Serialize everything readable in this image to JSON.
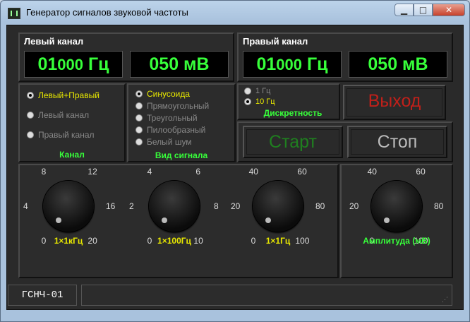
{
  "window": {
    "title": "Генератор сигналов звуковой частоты"
  },
  "left_channel": {
    "label": "Левый канал",
    "freq_main": "01",
    "freq_small": "000",
    "freq_unit": "Гц",
    "amp": "050 мВ"
  },
  "right_channel": {
    "label": "Правый канал",
    "freq_main": "01",
    "freq_small": "000",
    "freq_unit": "Гц",
    "amp": "050 мВ"
  },
  "channel": {
    "options": [
      "Левый+Правый",
      "Левый канал",
      "Правый канал"
    ],
    "selected": 0,
    "caption": "Канал"
  },
  "waveform": {
    "options": [
      "Синусоида",
      "Прямоугольный",
      "Треугольный",
      "Пилообразный",
      "Белый шум"
    ],
    "selected": 0,
    "caption": "Вид сигнала"
  },
  "discrete": {
    "options": [
      "1 Гц",
      "10 Гц"
    ],
    "selected": 1,
    "caption": "Дискретность"
  },
  "buttons": {
    "exit": "Выход",
    "start": "Старт",
    "stop": "Стоп"
  },
  "knobs": [
    {
      "caption": "1×1кГц",
      "ticks": [
        "0",
        "4",
        "8",
        "12",
        "16",
        "20"
      ],
      "value_fraction": 0.0
    },
    {
      "caption": "1×100Гц",
      "ticks": [
        "0",
        "2",
        "4",
        "6",
        "8",
        "10"
      ],
      "value_fraction": 0.0
    },
    {
      "caption": "1×1Гц",
      "ticks": [
        "0",
        "20",
        "40",
        "60",
        "80",
        "100"
      ],
      "value_fraction": 0.0
    },
    {
      "caption": "Амплитуда (мВ)",
      "ticks": [
        "0",
        "20",
        "40",
        "60",
        "80",
        "100"
      ],
      "value_fraction": 0.0
    }
  ],
  "status": {
    "device": "ГСНЧ-01",
    "message": ""
  },
  "colors": {
    "lcd_green": "#37ff3a",
    "yellow": "#e8e800",
    "exit_red": "#c0201a",
    "start_green": "#1f7f1f",
    "stop_gray": "#bbbbbb"
  }
}
